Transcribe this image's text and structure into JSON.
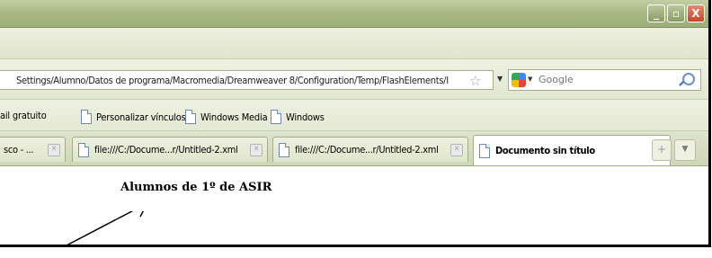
{
  "window": {
    "controls": {
      "minimize": "_",
      "maximize": "▫",
      "close": "X"
    }
  },
  "address": {
    "url": "Settings/Alumno/Datos de programa/Macromedia/Dreamweaver 8/Configuration/Temp/FlashElements/I",
    "search_placeholder": "Google"
  },
  "bookmarks": [
    "ail gratuito",
    "Personalizar vínculos",
    "Windows Media",
    "Windows"
  ],
  "tabs": [
    {
      "label": "sco - ...",
      "active": false
    },
    {
      "label": "file:///C:/Docume...r/Untitled-2.xml",
      "active": false
    },
    {
      "label": "file:///C:/Docume...r/Untitled-2.xml",
      "active": false
    },
    {
      "label": "Documento sin título",
      "active": true
    }
  ],
  "page": {
    "heading": "Alumnos de 1º de ASIR"
  }
}
